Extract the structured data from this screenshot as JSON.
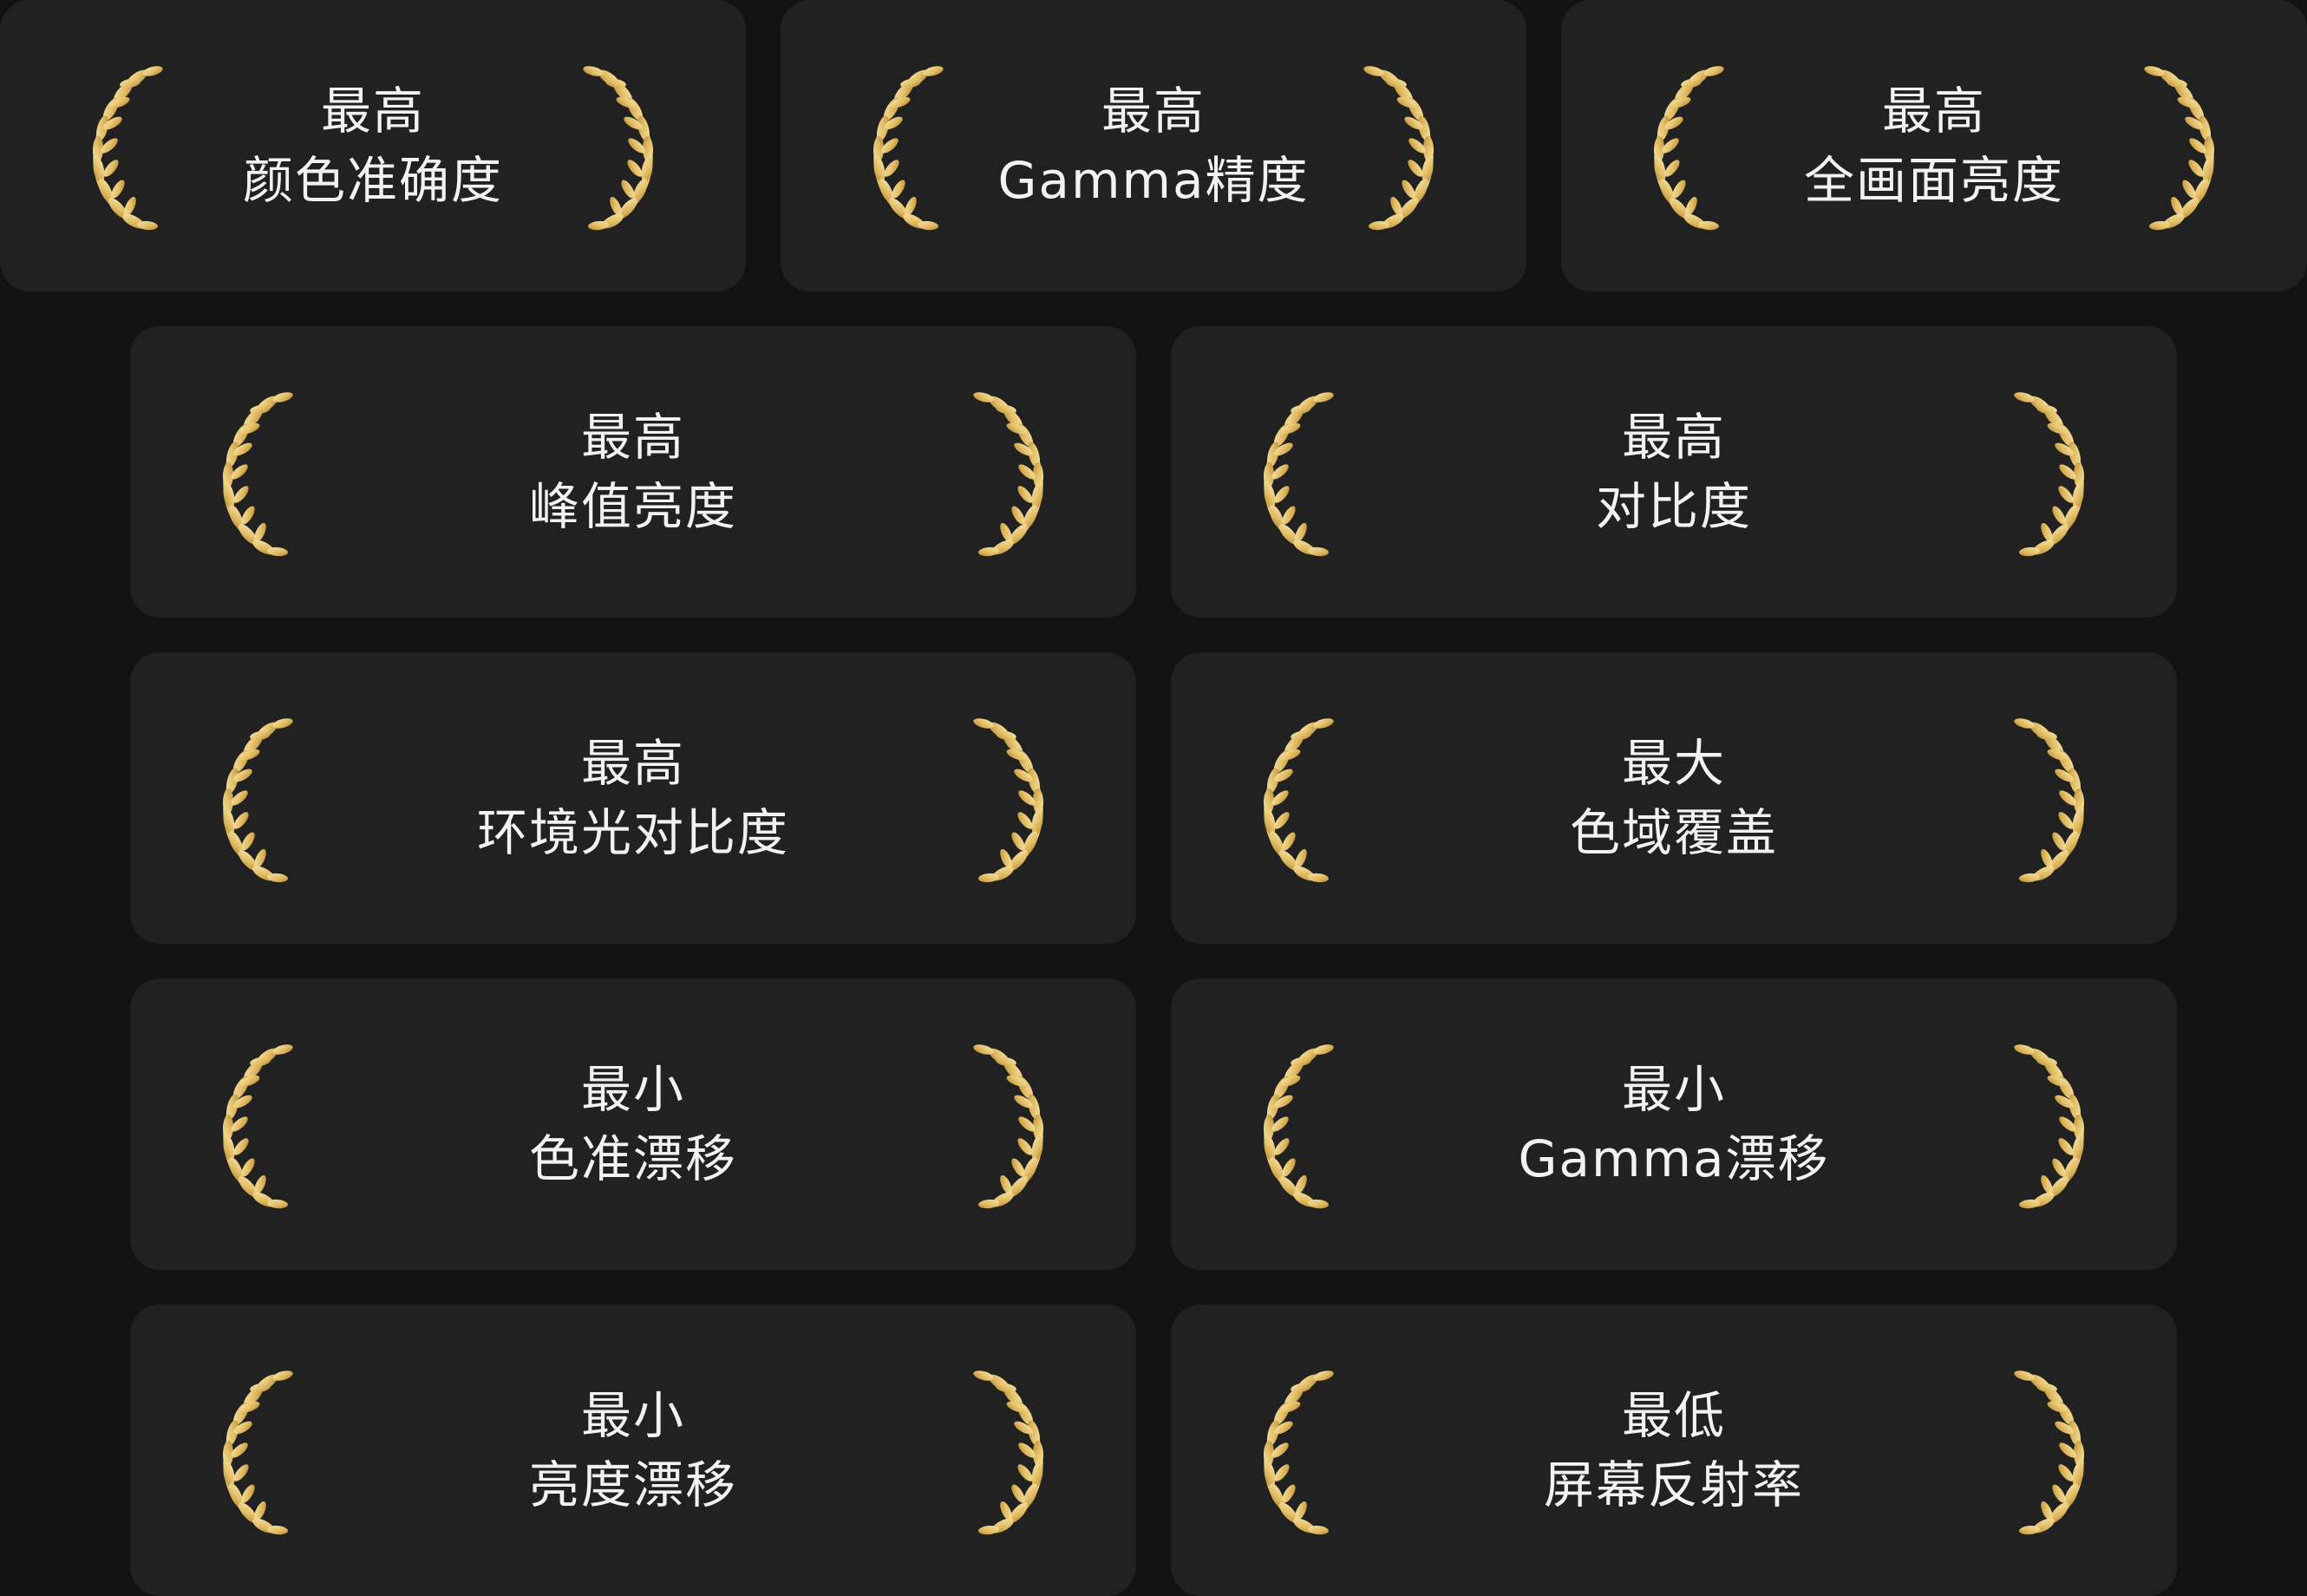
{
  "colors": {
    "page_background": "#121212",
    "card_background": "#212121",
    "text": "#f2f2f2",
    "laurel_gold_light": "#f6e3a3",
    "laurel_gold_dark": "#b88a2e"
  },
  "icons": {
    "left": "laurel-left-icon",
    "right": "laurel-right-icon"
  },
  "awards": [
    {
      "line1": "最高",
      "line2": "颜色准确度"
    },
    {
      "line1": "最高",
      "line2": "Gamma精度"
    },
    {
      "line1": "最高",
      "line2": "全画面亮度"
    },
    {
      "line1": "最高",
      "line2": "峰值亮度"
    },
    {
      "line1": "最高",
      "line2": "对比度"
    },
    {
      "line1": "最高",
      "line2": "环境光对比度"
    },
    {
      "line1": "最大",
      "line2": "色域覆盖"
    },
    {
      "line1": "最小",
      "line2": "色准漂移"
    },
    {
      "line1": "最小",
      "line2": "Gamma漂移"
    },
    {
      "line1": "最小",
      "line2": "亮度漂移"
    },
    {
      "line1": "最低",
      "line2": "屏幕反射率"
    }
  ]
}
